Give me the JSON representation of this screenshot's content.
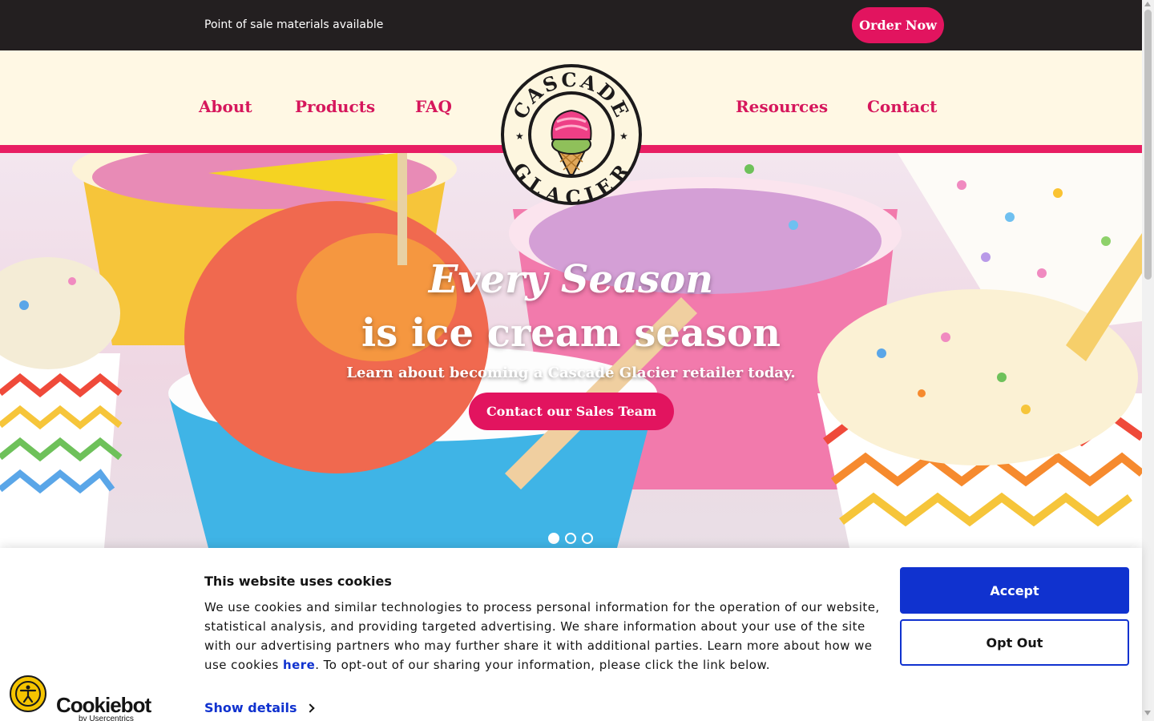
{
  "topbar": {
    "message": "Point of sale materials available",
    "order_button": "Order Now"
  },
  "nav": {
    "items": [
      {
        "label": "About"
      },
      {
        "label": "Products"
      },
      {
        "label": "FAQ"
      },
      {
        "label": "Resources"
      },
      {
        "label": "Contact"
      }
    ],
    "logo": {
      "top_text": "CASCADE",
      "bottom_text": "GLACIER"
    }
  },
  "hero": {
    "script_text": "Every Season",
    "title": "is ice cream season",
    "subtitle": "Learn about becoming a Cascade Glacier retailer today.",
    "cta": "Contact our Sales Team",
    "slides_total": 3,
    "active_slide": 1
  },
  "cookie_banner": {
    "title": "This website uses cookies",
    "body_before_link": "We use cookies and similar technologies to process personal information for the operation of our website, statistical analysis, and providing targeted advertising. We share information about your use of the site with our advertising partners who may further share it with additional parties. Learn more about how we use cookies ",
    "link_text": "here",
    "body_after_link": ". To opt-out of our sharing your information, please click the link below.",
    "show_details": "Show details",
    "accept": "Accept",
    "opt_out": "Opt Out",
    "brand": "Cookiebot",
    "brand_sub": "by Usercentrics"
  },
  "colors": {
    "brand_pink": "#e2145f",
    "nav_background": "#fff8e4",
    "topbar_background": "#231f20",
    "cookie_blue": "#1032cf"
  },
  "icons": [
    "accessibility-icon",
    "chevron-right-icon",
    "cookiebot-logo"
  ]
}
